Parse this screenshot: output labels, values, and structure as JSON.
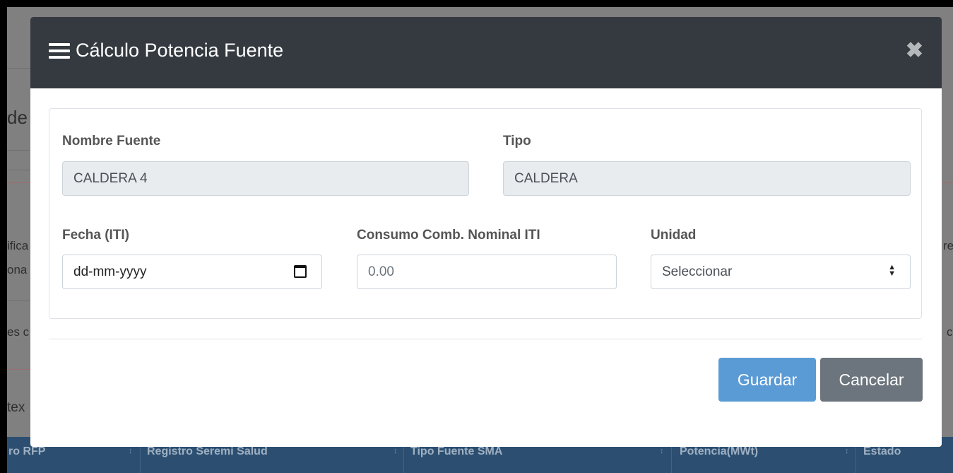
{
  "background": {
    "fragments": [
      "de",
      "ifica",
      "ona",
      "es c",
      "tex",
      "re",
      "c"
    ],
    "table_headers": [
      "ro RFP",
      "Registro Seremi Salud",
      "Tipo Fuente SMA",
      "Potencia(MWt)",
      "Estado"
    ]
  },
  "modal": {
    "title": "Cálculo Potencia Fuente",
    "title_icon": "menu-icon",
    "close_icon": "close-icon",
    "close_glyph": "✖",
    "fields": {
      "nombre_fuente": {
        "label": "Nombre Fuente",
        "value": "CALDERA 4"
      },
      "tipo": {
        "label": "Tipo",
        "value": "CALDERA"
      },
      "fecha": {
        "label": "Fecha (ITI)",
        "placeholder": "dd-mm-yyyy"
      },
      "consumo": {
        "label": "Consumo Comb. Nominal ITI",
        "placeholder": "0.00"
      },
      "unidad": {
        "label": "Unidad",
        "selected": "Seleccionar"
      }
    },
    "buttons": {
      "save": "Guardar",
      "cancel": "Cancelar"
    },
    "colors": {
      "header_bg": "#343a40",
      "save_bg": "#5b9bd5",
      "cancel_bg": "#6c757d"
    }
  }
}
